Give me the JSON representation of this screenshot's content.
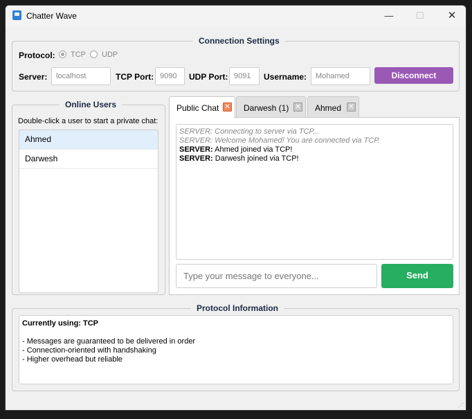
{
  "window": {
    "title": "Chatter Wave",
    "minimize_glyph": "—",
    "maximize_glyph": "☐",
    "close_glyph": "✕"
  },
  "connection": {
    "legend": "Connection Settings",
    "protocol_label": "Protocol:",
    "tcp_label": "TCP",
    "udp_label": "UDP",
    "selected_protocol": "TCP",
    "server_label": "Server:",
    "server_value": "localhost",
    "tcp_port_label": "TCP Port:",
    "tcp_port_value": "9090",
    "udp_port_label": "UDP Port:",
    "udp_port_value": "9091",
    "username_label": "Username:",
    "username_value": "Mohamed",
    "disconnect_label": "Disconnect"
  },
  "users": {
    "legend": "Online Users",
    "hint": "Double-click a user to start a private chat:",
    "items": [
      {
        "name": "Ahmed",
        "selected": true
      },
      {
        "name": "Darwesh",
        "selected": false
      }
    ]
  },
  "tabs": [
    {
      "label": "Public Chat",
      "active": true
    },
    {
      "label": "Darwesh (1)",
      "active": false
    },
    {
      "label": "Ahmed",
      "active": false
    }
  ],
  "chat": {
    "messages": [
      {
        "type": "status",
        "text": "SERVER: Connecting to server via TCP..."
      },
      {
        "type": "status",
        "text": "SERVER: Welcome Mohamed! You are connected via TCP."
      },
      {
        "type": "message",
        "sender": "SERVER:",
        "text": " Ahmed joined via TCP!"
      },
      {
        "type": "message",
        "sender": "SERVER:",
        "text": " Darwesh joined via TCP!"
      }
    ],
    "input_placeholder": "Type your message to everyone...",
    "send_label": "Send"
  },
  "protocol_info": {
    "legend": "Protocol Information",
    "heading": "Currently using: TCP",
    "lines": [
      "- Messages are guaranteed to be delivered in order",
      "- Connection-oriented with handshaking",
      "- Higher overhead but reliable"
    ]
  },
  "colors": {
    "disconnect": "#9b59b6",
    "send": "#27ae60",
    "selected_user": "#e1eefc"
  }
}
